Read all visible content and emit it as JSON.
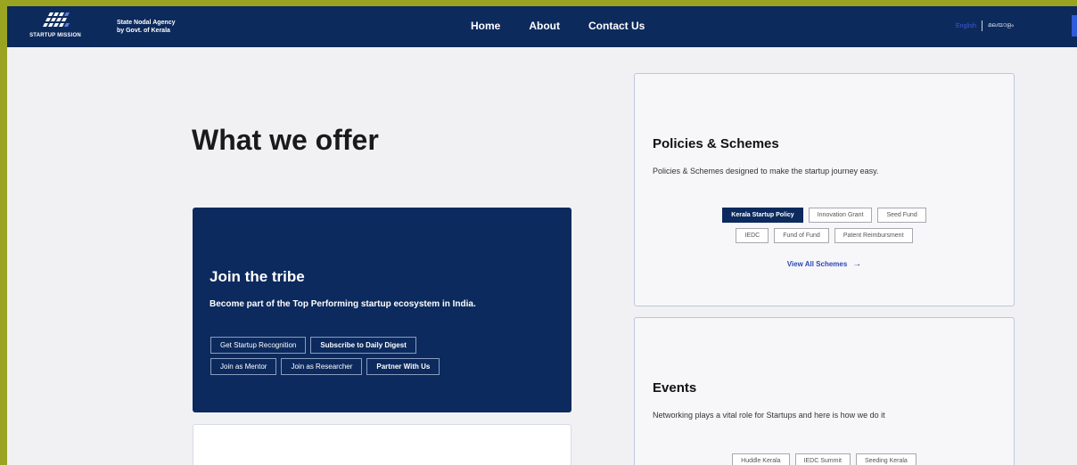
{
  "header": {
    "logo_text": "STARTUP MISSION",
    "agency_line1": "State Nodal Agency",
    "agency_line2": "by Govt. of Kerala",
    "nav": [
      "Home",
      "About",
      "Contact Us"
    ],
    "lang_en": "English",
    "lang_ml": "മലയാളം"
  },
  "main": {
    "title": "What we offer"
  },
  "tribe": {
    "title": "Join the tribe",
    "desc": "Become part of the Top Performing startup ecosystem in India.",
    "buttons_row1": [
      "Get Startup Recognition",
      "Subscribe to Daily Digest"
    ],
    "buttons_row2": [
      "Join as Mentor",
      "Join as Researcher",
      "Partner With Us"
    ]
  },
  "policies": {
    "title": "Policies & Schemes",
    "desc": "Policies & Schemes designed to make the startup journey easy.",
    "tags_row1": [
      "Kerala Startup Policy",
      "Innovation Grant",
      "Seed Fund"
    ],
    "tags_row2": [
      "IEDC",
      "Fund of Fund",
      "Patent Reimbursment"
    ],
    "view_all": "View All Schemes",
    "arrow": "→"
  },
  "events": {
    "title": "Events",
    "desc": "Networking plays a vital role for Startups and here is how we do it",
    "tags_row1": [
      "Huddle Kerala",
      "IEDC Summit",
      "Seeding Kerala"
    ]
  },
  "colors": {
    "navy": "#0c2a5d",
    "accent_blue": "#2a48b8",
    "border_green": "#9aa421"
  }
}
